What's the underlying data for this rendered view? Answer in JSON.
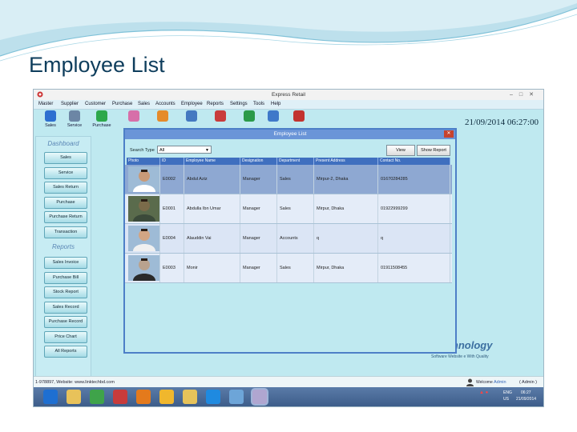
{
  "slide": {
    "title": "Employee List"
  },
  "window": {
    "title": "Express Retail"
  },
  "menu": [
    "Master",
    "Supplier",
    "Customer",
    "Purchase",
    "Sales",
    "Accounts",
    "Employee",
    "Reports",
    "Settings",
    "Tools",
    "Help"
  ],
  "toolbar": [
    {
      "label": "Sales",
      "icon": "cart-icon",
      "color": "#2d6fd0"
    },
    {
      "label": "Service",
      "icon": "gears-icon",
      "color": "#6c86a5"
    },
    {
      "label": "Purchase",
      "icon": "basket-icon",
      "color": "#2da84b"
    },
    {
      "label": "",
      "icon": "users-icon",
      "color": "#d76fa9"
    },
    {
      "label": "",
      "icon": "home-icon",
      "color": "#e58b2a"
    },
    {
      "label": "",
      "icon": "person-icon",
      "color": "#4479c0"
    },
    {
      "label": "",
      "icon": "report-icon",
      "color": "#c93c3c"
    },
    {
      "label": "",
      "icon": "cart-add-icon",
      "color": "#2b9a49"
    },
    {
      "label": "",
      "icon": "lock-icon",
      "color": "#3f79c9"
    },
    {
      "label": "",
      "icon": "logout-icon",
      "color": "#c2332f"
    }
  ],
  "datetime": "21/09/2014 06:27:00",
  "sidebar": {
    "dashboard_title": "Dashboard",
    "dashboard_items": [
      "Sales",
      "Service",
      "Sales Return",
      "Purchase",
      "Purchase Return",
      "Transaction"
    ],
    "reports_title": "Reports",
    "reports_items": [
      "Sales Invoice",
      "Purchase Bill",
      "Stock Report",
      "Sales Record",
      "Purchase Record",
      "Price Chart",
      "All Reports"
    ]
  },
  "dialog": {
    "title": "Employee List",
    "search_label": "Search Type",
    "search_value": "All",
    "view_label": "View",
    "report_label": "Show Report",
    "columns": [
      "Photo",
      "ID",
      "Employee Name",
      "Designation",
      "Department",
      "Present Address",
      "Contact No."
    ],
    "rows": [
      {
        "id": "E0002",
        "name": "Abdul Aziz",
        "designation": "Manager",
        "department": "Sales",
        "address": "Mirpur-2, Dhaka",
        "contact": "01670284285"
      },
      {
        "id": "E0001",
        "name": "Abdulla Ibn Umar",
        "designation": "Manager",
        "department": "Sales",
        "address": "Mirpur, Dhaka",
        "contact": "01922999299"
      },
      {
        "id": "E0004",
        "name": "Alauddin Vai",
        "designation": "Manager",
        "department": "Accounts",
        "address": "q",
        "contact": "q"
      },
      {
        "id": "E0003",
        "name": "Monir",
        "designation": "Manager",
        "department": "Sales",
        "address": "Mirpur, Dhaka",
        "contact": "01911508455"
      }
    ]
  },
  "status": {
    "left": "1-978897, Website: www.linktechbd.com",
    "welcome": "Welcome",
    "user": "Admin",
    "role": "( Admin )"
  },
  "watermark": {
    "brand": "Link-Up Technology",
    "tagline": "Software Website e With Quality"
  },
  "tray": {
    "lang1": "ENG",
    "lang2": "US",
    "time": "06:27",
    "date": "21/09/2014"
  },
  "taskbar_icons": [
    "ie-icon",
    "explorer-icon",
    "chrome-icon",
    "app-red-icon",
    "firefox-icon",
    "folder-icon",
    "folder2-icon",
    "skype-icon",
    "app-blue-icon",
    "app-active-icon"
  ]
}
